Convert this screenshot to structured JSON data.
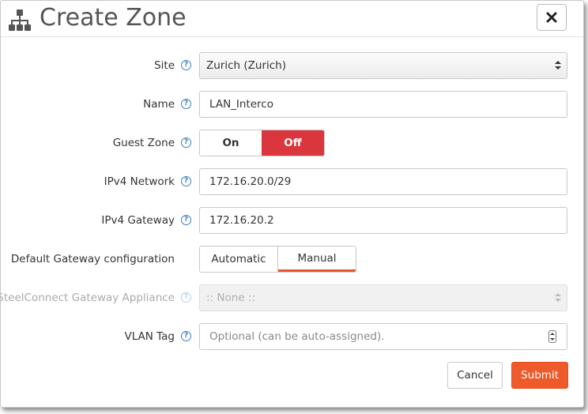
{
  "dialog": {
    "title": "Create Zone",
    "icon": "sitemap-icon",
    "close": "close-icon"
  },
  "form": {
    "site": {
      "label": "Site",
      "value": "Zurich (Zurich)"
    },
    "name": {
      "label": "Name",
      "value": "LAN_Interco"
    },
    "guest_zone": {
      "label": "Guest Zone",
      "on": "On",
      "off": "Off",
      "selected": "Off"
    },
    "ipv4_network": {
      "label": "IPv4 Network",
      "value": "172.16.20.0/29"
    },
    "ipv4_gateway": {
      "label": "IPv4 Gateway",
      "value": "172.16.20.2"
    },
    "default_gateway": {
      "label": "Default Gateway configuration",
      "automatic": "Automatic",
      "manual": "Manual",
      "selected": "Manual"
    },
    "appliance": {
      "label": "SteelConnect Gateway Appliance",
      "value": ":: None ::",
      "disabled": true
    },
    "vlan_tag": {
      "label": "VLAN Tag",
      "placeholder": "Optional (can be auto-assigned)."
    },
    "help_glyph": "?"
  },
  "footer": {
    "cancel": "Cancel",
    "submit": "Submit"
  },
  "colors": {
    "accent": "#ee5a29",
    "off_active": "#d9363e",
    "help": "#3b7ec2"
  }
}
